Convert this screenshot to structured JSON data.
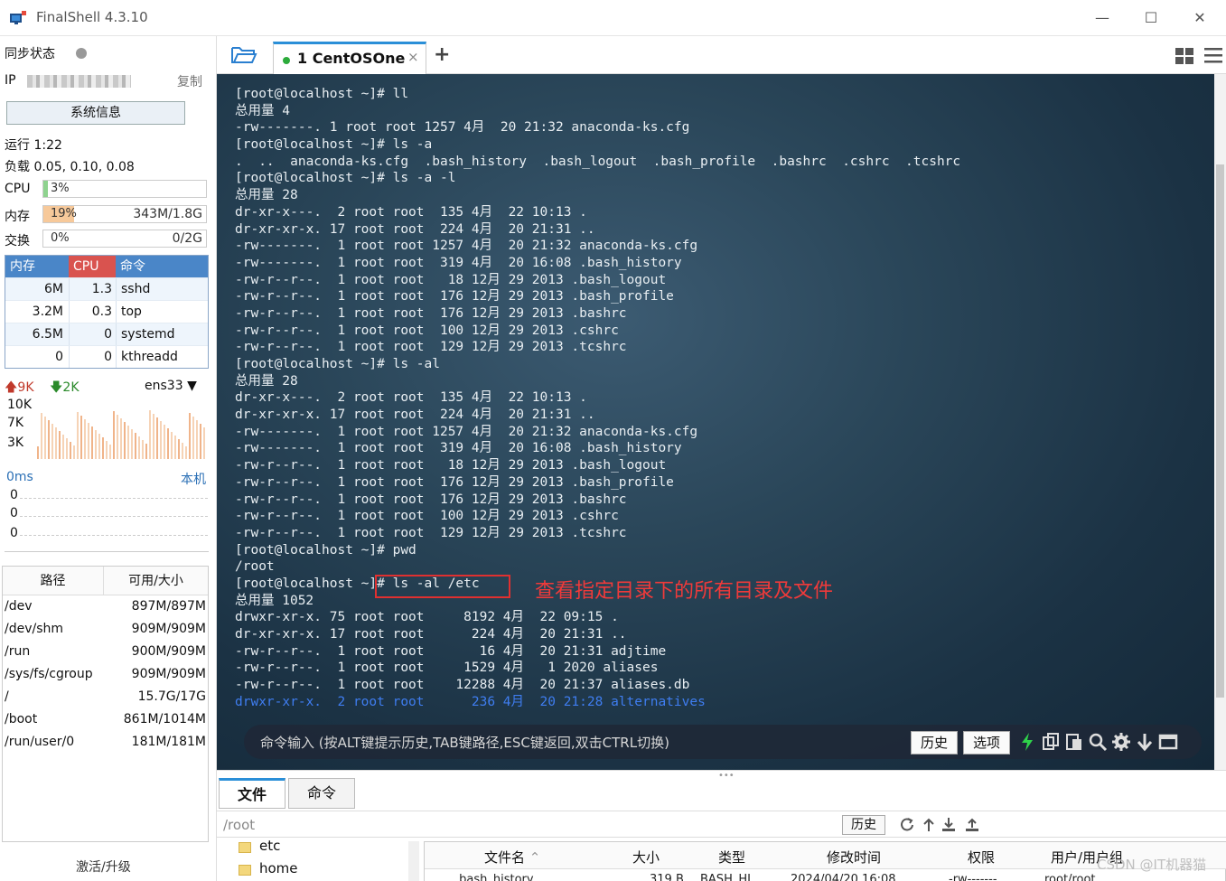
{
  "window": {
    "title": "FinalShell 4.3.10"
  },
  "sidebar": {
    "sync_label": "同步状态",
    "ip_label": "IP",
    "copy_label": "复制",
    "sysinfo_button": "系统信息",
    "uptime": "运行 1:22",
    "load": "负载 0.05, 0.10, 0.08",
    "cpu": {
      "label": "CPU",
      "percent": "3%",
      "level": 0.03
    },
    "mem": {
      "label": "内存",
      "percent": "19%",
      "amount": "343M/1.8G",
      "level": 0.19
    },
    "swap": {
      "label": "交换",
      "percent": "0%",
      "amount": "0/2G",
      "level": 0
    },
    "proc_headers": [
      "内存",
      "CPU",
      "命令"
    ],
    "processes": [
      {
        "mem": "6M",
        "cpu": "1.3",
        "cmd": "sshd"
      },
      {
        "mem": "3.2M",
        "cpu": "0.3",
        "cmd": "top"
      },
      {
        "mem": "6.5M",
        "cpu": "0",
        "cmd": "systemd"
      },
      {
        "mem": "0",
        "cpu": "0",
        "cmd": "kthreadd"
      }
    ],
    "net": {
      "up": "9K",
      "down": "2K",
      "iface": "ens33",
      "scale": [
        "10K",
        "7K",
        "3K"
      ]
    },
    "ping": {
      "latency": "0ms",
      "host": "本机",
      "values": [
        "0",
        "0",
        "0"
      ]
    },
    "disk_headers": [
      "路径",
      "可用/大小"
    ],
    "disks": [
      {
        "path": "/dev",
        "size": "897M/897M"
      },
      {
        "path": "/dev/shm",
        "size": "909M/909M"
      },
      {
        "path": "/run",
        "size": "900M/909M"
      },
      {
        "path": "/sys/fs/cgroup",
        "size": "909M/909M"
      },
      {
        "path": "/",
        "size": "15.7G/17G"
      },
      {
        "path": "/boot",
        "size": "861M/1014M"
      },
      {
        "path": "/run/user/0",
        "size": "181M/181M"
      }
    ],
    "upgrade": "激活/升级"
  },
  "tabs": [
    {
      "label": "1 CentOSOne",
      "close": "×"
    }
  ],
  "tab_plus": "+",
  "terminal": {
    "lines": [
      "[root@localhost ~]# ll",
      "总用量 4",
      "-rw-------. 1 root root 1257 4月  20 21:32 anaconda-ks.cfg",
      "[root@localhost ~]# ls -a",
      ".  ..  anaconda-ks.cfg  .bash_history  .bash_logout  .bash_profile  .bashrc  .cshrc  .tcshrc",
      "[root@localhost ~]# ls -a -l",
      "总用量 28",
      "dr-xr-x---.  2 root root  135 4月  22 10:13 .",
      "dr-xr-xr-x. 17 root root  224 4月  20 21:31 ..",
      "-rw-------.  1 root root 1257 4月  20 21:32 anaconda-ks.cfg",
      "-rw-------.  1 root root  319 4月  20 16:08 .bash_history",
      "-rw-r--r--.  1 root root   18 12月 29 2013 .bash_logout",
      "-rw-r--r--.  1 root root  176 12月 29 2013 .bash_profile",
      "-rw-r--r--.  1 root root  176 12月 29 2013 .bashrc",
      "-rw-r--r--.  1 root root  100 12月 29 2013 .cshrc",
      "-rw-r--r--.  1 root root  129 12月 29 2013 .tcshrc",
      "[root@localhost ~]# ls -al",
      "总用量 28",
      "dr-xr-x---.  2 root root  135 4月  22 10:13 .",
      "dr-xr-xr-x. 17 root root  224 4月  20 21:31 ..",
      "-rw-------.  1 root root 1257 4月  20 21:32 anaconda-ks.cfg",
      "-rw-------.  1 root root  319 4月  20 16:08 .bash_history",
      "-rw-r--r--.  1 root root   18 12月 29 2013 .bash_logout",
      "-rw-r--r--.  1 root root  176 12月 29 2013 .bash_profile",
      "-rw-r--r--.  1 root root  176 12月 29 2013 .bashrc",
      "-rw-r--r--.  1 root root  100 12月 29 2013 .cshrc",
      "-rw-r--r--.  1 root root  129 12月 29 2013 .tcshrc",
      "[root@localhost ~]# pwd",
      "/root",
      "[root@localhost ~]# ls -al /etc",
      "总用量 1052",
      "drwxr-xr-x. 75 root root     8192 4月  22 09:15 .",
      "dr-xr-xr-x. 17 root root      224 4月  20 21:31 ..",
      "-rw-r--r--.  1 root root       16 4月  20 21:31 adjtime",
      "-rw-r--r--.  1 root root     1529 4月   1 2020 aliases",
      "-rw-r--r--.  1 root root    12288 4月  20 21:37 aliases.db",
      "drwxr-xr-x.  2 root root      236 4月  20 21:28 alternatives"
    ],
    "annotation": "查看指定目录下的所有目录及文件",
    "cmd_placeholder": "命令输入 (按ALT键提示历史,TAB键路径,ESC键返回,双击CTRL切换)",
    "history_button": "历史",
    "options_button": "选项"
  },
  "bottom": {
    "tabs": [
      "文件",
      "命令"
    ],
    "path": "/root",
    "history_button": "历史",
    "tree": [
      "etc",
      "home"
    ],
    "file_headers": [
      "文件名",
      "大小",
      "类型",
      "修改时间",
      "权限",
      "用户/用户组"
    ],
    "file_row": [
      ".bash_history",
      "319 B",
      "BASH_HI...",
      "2024/04/20 16:08",
      "-rw-------",
      "root/root"
    ]
  },
  "watermark": "CSDN @IT机器猫",
  "colors": {
    "accent": "#2a8fd8",
    "mem_fill": "#f7c99a",
    "cpu_fill": "#8fd38f",
    "annotation": "#f03a3a",
    "proc_header": "#4a86c8",
    "proc_cpu_header": "#d9534f"
  }
}
